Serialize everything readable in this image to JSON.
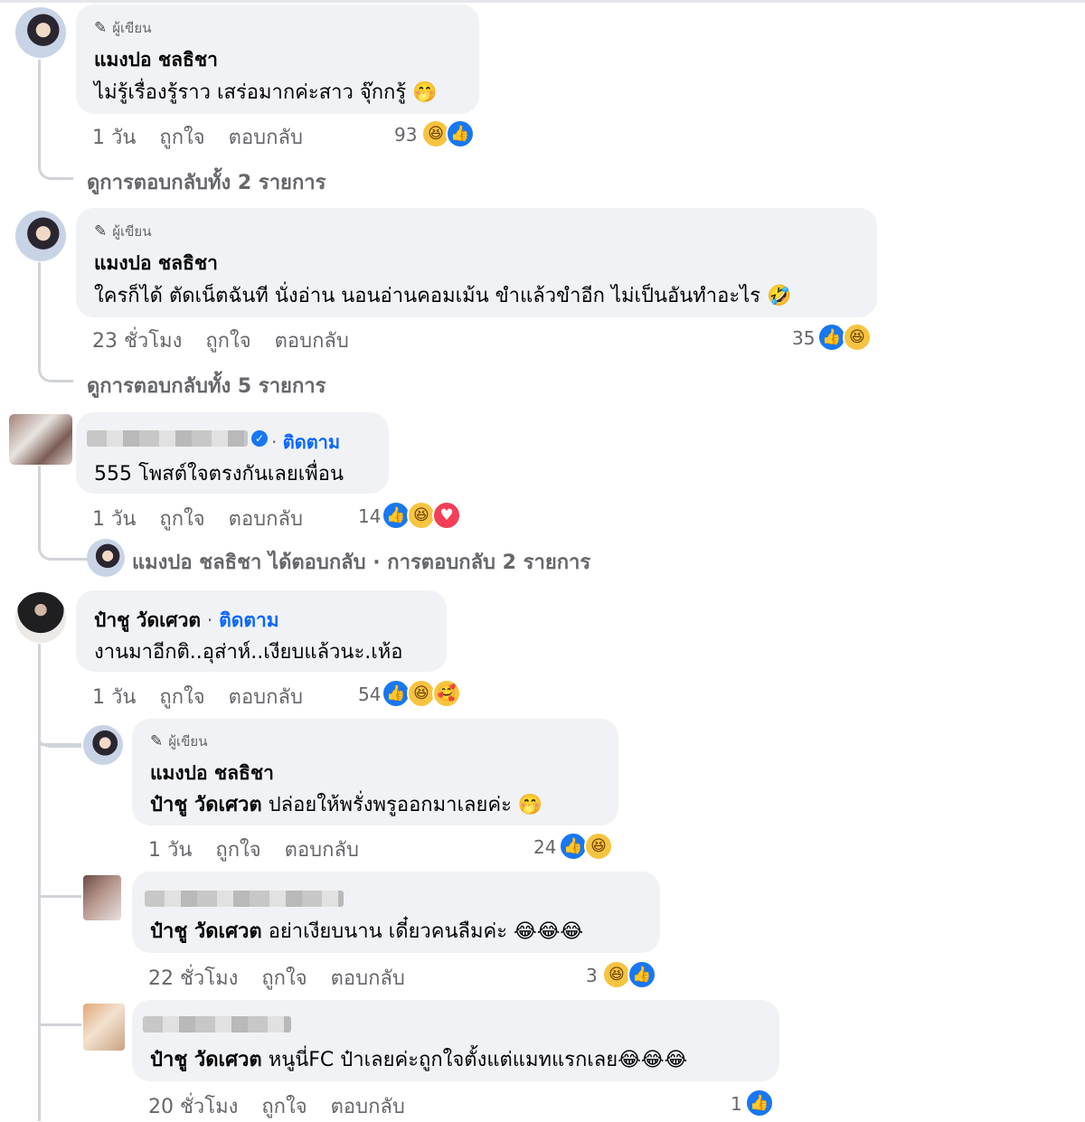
{
  "author_badge": "ผู้เขียน",
  "actions": {
    "like": "ถูกใจ",
    "reply": "ตอบกลับ",
    "follow": "ติดตาม"
  },
  "icons": {
    "pen": "pen-icon",
    "like": "like-reaction-icon",
    "haha": "haha-reaction-icon",
    "love": "love-reaction-icon",
    "care": "care-reaction-icon",
    "verified": "verified-badge-icon"
  },
  "comments": [
    {
      "name": "แมงปอ ชลธิชา",
      "text": "ไม่รู้เรื่องรู้ราว เสร่อมากค่ะสาว จุ๊กกรู้",
      "emoji": "🤭",
      "time": "1 วัน",
      "count": "93",
      "see_more": "ดูการตอบกลับทั้ง 2 รายการ"
    },
    {
      "name": "แมงปอ ชลธิชา",
      "text": "ใครก็ได้ ตัดเน็ตฉันที นั่งอ่าน นอนอ่านคอมเม้น ขำแล้วขำอีก ไม่เป็นอันทำอะไร",
      "emoji": "🤣",
      "time": "23 ชั่วโมง",
      "count": "35",
      "see_more": "ดูการตอบกลับทั้ง 5 รายการ"
    },
    {
      "text": "555 โพสต์ใจตรงกันเลยเพื่อน",
      "time": "1 วัน",
      "count": "14",
      "reply_summary": "แมงปอ ชลธิชา ได้ตอบกลับ · การตอบกลับ 2 รายการ"
    },
    {
      "name": "ป๋าชู วัดเศวต",
      "text": "งานมาอีกติ..อุส่าห์..เงียบแล้วนะ.เห้อ",
      "time": "1 วัน",
      "count": "54",
      "replies": [
        {
          "name": "แมงปอ ชลธิชา",
          "mention": "ป๋าชู วัดเศวต",
          "text": "ปล่อยให้พรั่งพรูออกมาเลยค่ะ",
          "emoji": "🤭",
          "time": "1 วัน",
          "count": "24"
        },
        {
          "mention": "ป๋าชู วัดเศวต",
          "text": "อย่าเงียบนาน เดี๋ยวคนลืมค่ะ",
          "emoji": "😂😂😂",
          "time": "22 ชั่วโมง",
          "count": "3"
        },
        {
          "mention": "ป๋าชู วัดเศวต",
          "text": "หนูนี่FC ป๋าเลยค่ะถูกใจตั้งแต่แมทแรกเลย",
          "emoji": "😂😂😂",
          "time": "20 ชั่วโมง",
          "count": "1"
        }
      ]
    }
  ],
  "colors": {
    "like_blue": "#1877f2",
    "follow_blue": "#0866ff",
    "bubble": "#f0f2f5",
    "meta_gray": "#65676b"
  }
}
